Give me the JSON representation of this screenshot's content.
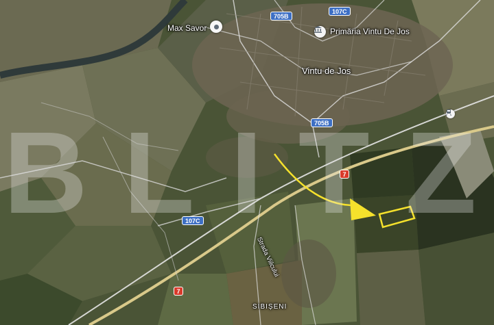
{
  "map": {
    "type": "satellite",
    "places": {
      "town": "Vintu de Jos",
      "village": "SIBIȘENI",
      "poi_1": "Max Savor",
      "poi_2": "Primăria Vintu De Jos",
      "street": "Strada Viilcului"
    },
    "roads": {
      "r1": "705B",
      "r2": "107C",
      "r3": "705B",
      "r4": "7",
      "r5": "107C",
      "r6": "7"
    },
    "watermark": "BLITZ",
    "annotation": {
      "arrow_color": "#f5e12c",
      "parcel_outline_color": "#f5e12c"
    },
    "icons": [
      "place-pin-icon",
      "town-hall-icon",
      "train-station-icon"
    ]
  }
}
